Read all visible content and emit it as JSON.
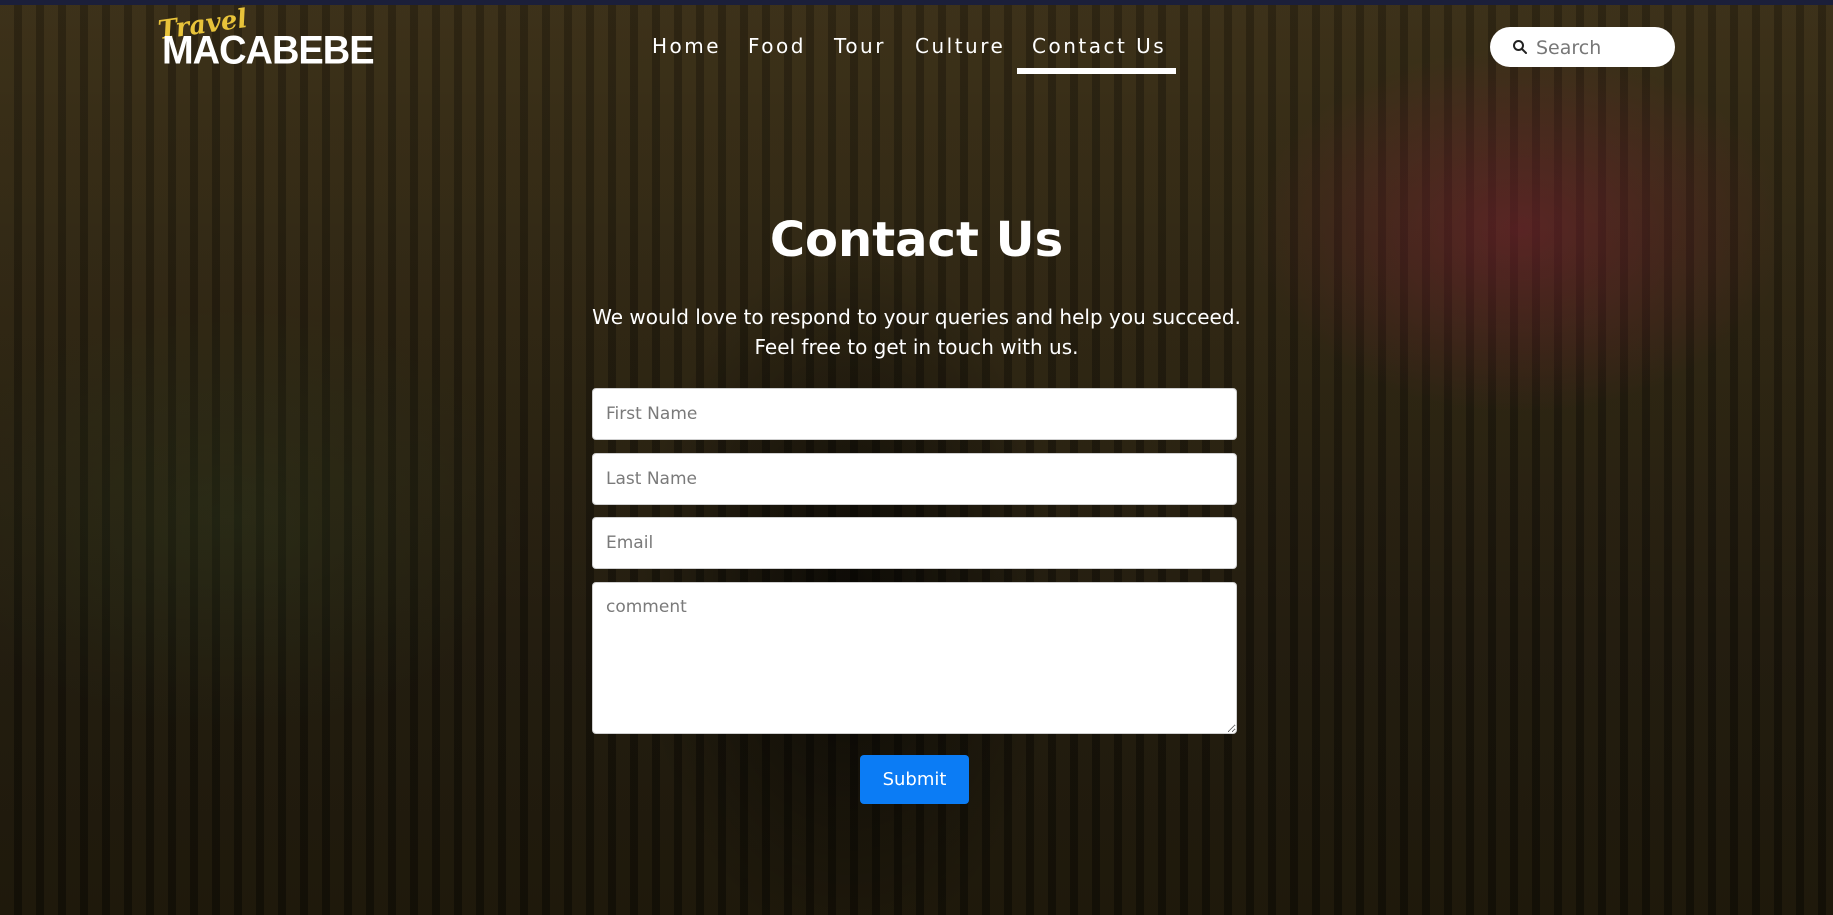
{
  "logo": {
    "script_text": "Travel",
    "main_text": "MACABEBE"
  },
  "nav": {
    "items": [
      {
        "label": "Home"
      },
      {
        "label": "Food"
      },
      {
        "label": "Tour"
      },
      {
        "label": "Culture"
      },
      {
        "label": "Contact Us",
        "active": true
      }
    ]
  },
  "search": {
    "placeholder": "Search",
    "icon": "search-icon"
  },
  "main": {
    "title": "Contact Us",
    "subtitle_line1": "We would love to respond to your queries and help you succeed.",
    "subtitle_line2": "Feel free to get in touch with us."
  },
  "form": {
    "first_name_placeholder": "First Name",
    "last_name_placeholder": "Last Name",
    "email_placeholder": "Email",
    "comment_placeholder": "comment",
    "submit_label": "Submit"
  },
  "colors": {
    "accent": "#0b7cf5",
    "logo_script": "#e8c33a",
    "text": "#ffffff"
  }
}
